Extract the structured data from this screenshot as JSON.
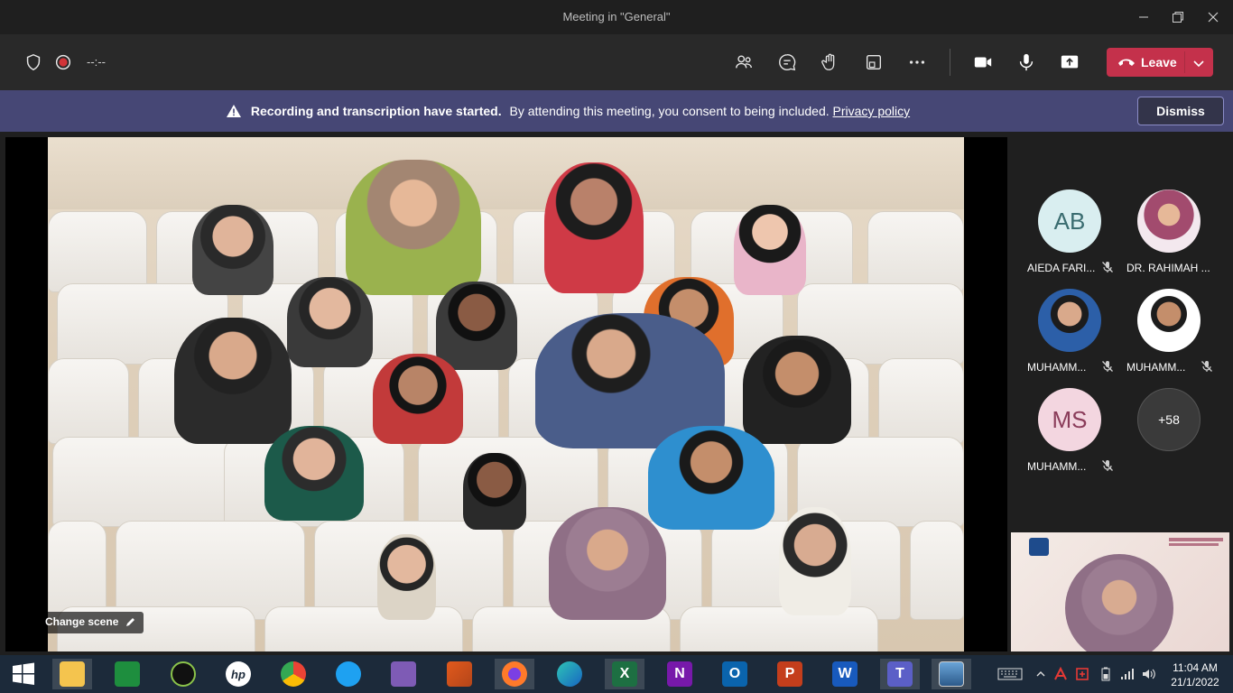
{
  "window": {
    "title": "Meeting in \"General\"",
    "minimize_icon": "minimize-icon",
    "maximize_icon": "restore-icon",
    "close_icon": "close-icon"
  },
  "toolbar": {
    "timer": "--:--",
    "leave_label": "Leave",
    "icons": [
      "shield-icon",
      "record-icon",
      "people-icon",
      "chat-icon",
      "raise-hand-icon",
      "rooms-icon",
      "more-icon",
      "camera-icon",
      "mic-icon",
      "share-icon",
      "phone-icon",
      "chevron-down-icon"
    ],
    "leave_color": "#c4314b"
  },
  "banner": {
    "bold_text": "Recording and transcription have started.",
    "text": "By attending this meeting, you consent to being included.",
    "link_text": "Privacy policy",
    "dismiss_label": "Dismiss",
    "background": "#464775"
  },
  "stage": {
    "change_scene_label": "Change scene"
  },
  "participants": [
    {
      "initials": "AB",
      "name": "AIEDA FARI...",
      "muted": true,
      "avatar_color": "#d9eef0"
    },
    {
      "initials": "",
      "name": "DR. RAHIMAH ...",
      "muted": false,
      "avatar_color": "#e8d9e4"
    },
    {
      "initials": "",
      "name": "MUHAMM...",
      "muted": true,
      "avatar_color": "#2c5fa8"
    },
    {
      "initials": "",
      "name": "MUHAMM...",
      "muted": true,
      "avatar_color": "#ffffff"
    },
    {
      "initials": "MS",
      "name": "MUHAMM...",
      "muted": true,
      "avatar_color": "#f3d6e0"
    },
    {
      "initials": "+58",
      "name": "",
      "muted": false,
      "avatar_color": "#3a3a3a"
    }
  ],
  "taskbar": {
    "apps": [
      "windows-start-icon",
      "file-explorer-icon",
      "store-icon",
      "webcam-icon",
      "hp-icon",
      "chrome-icon",
      "internet-explorer-icon",
      "visual-studio-icon",
      "matlab-icon",
      "firefox-icon",
      "edge-icon",
      "excel-icon",
      "onenote-icon",
      "outlook-icon",
      "powerpoint-icon",
      "word-icon",
      "teams-icon",
      "photos-icon"
    ],
    "app_labels": {
      "hp": "hp",
      "excel": "X",
      "onenote": "N",
      "outlook": "O",
      "powerpoint": "P",
      "word": "W",
      "teams": "T"
    },
    "tray_icons": [
      "keyboard-icon",
      "chevron-up-icon",
      "acrobat-icon",
      "security-icon",
      "battery-icon",
      "wifi-icon",
      "volume-icon"
    ],
    "time": "11:04 AM",
    "date": "21/1/2022"
  }
}
